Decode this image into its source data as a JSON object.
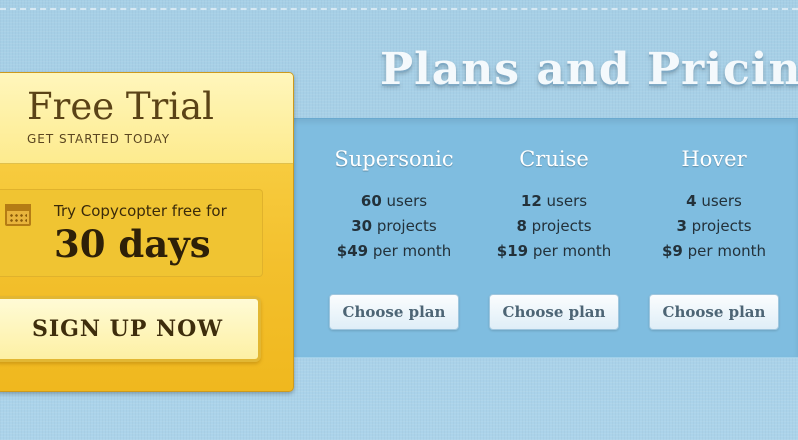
{
  "page": {
    "title": "Plans and Pricing"
  },
  "trial": {
    "title": "Free Trial",
    "subtitle": "GET STARTED TODAY",
    "try_text": "Try Copycopter free for",
    "days_text": "30 days",
    "icon": "calendar-icon",
    "signup_label": "SIGN UP NOW"
  },
  "plans": [
    {
      "name": "Supersonic",
      "users_num": "60",
      "users_label": "users",
      "projects_num": "30",
      "projects_label": "projects",
      "price": "$49",
      "price_label": "per month",
      "button": "Choose plan"
    },
    {
      "name": "Cruise",
      "users_num": "12",
      "users_label": "users",
      "projects_num": "8",
      "projects_label": "projects",
      "price": "$19",
      "price_label": "per month",
      "button": "Choose plan"
    },
    {
      "name": "Hover",
      "users_num": "4",
      "users_label": "users",
      "projects_num": "3",
      "projects_label": "projects",
      "price": "$9",
      "price_label": "per month",
      "button": "Choose plan"
    }
  ],
  "colors": {
    "background": "#a9d1e8",
    "band": "#7fbde0",
    "trial_yellow": "#f3c02d"
  }
}
